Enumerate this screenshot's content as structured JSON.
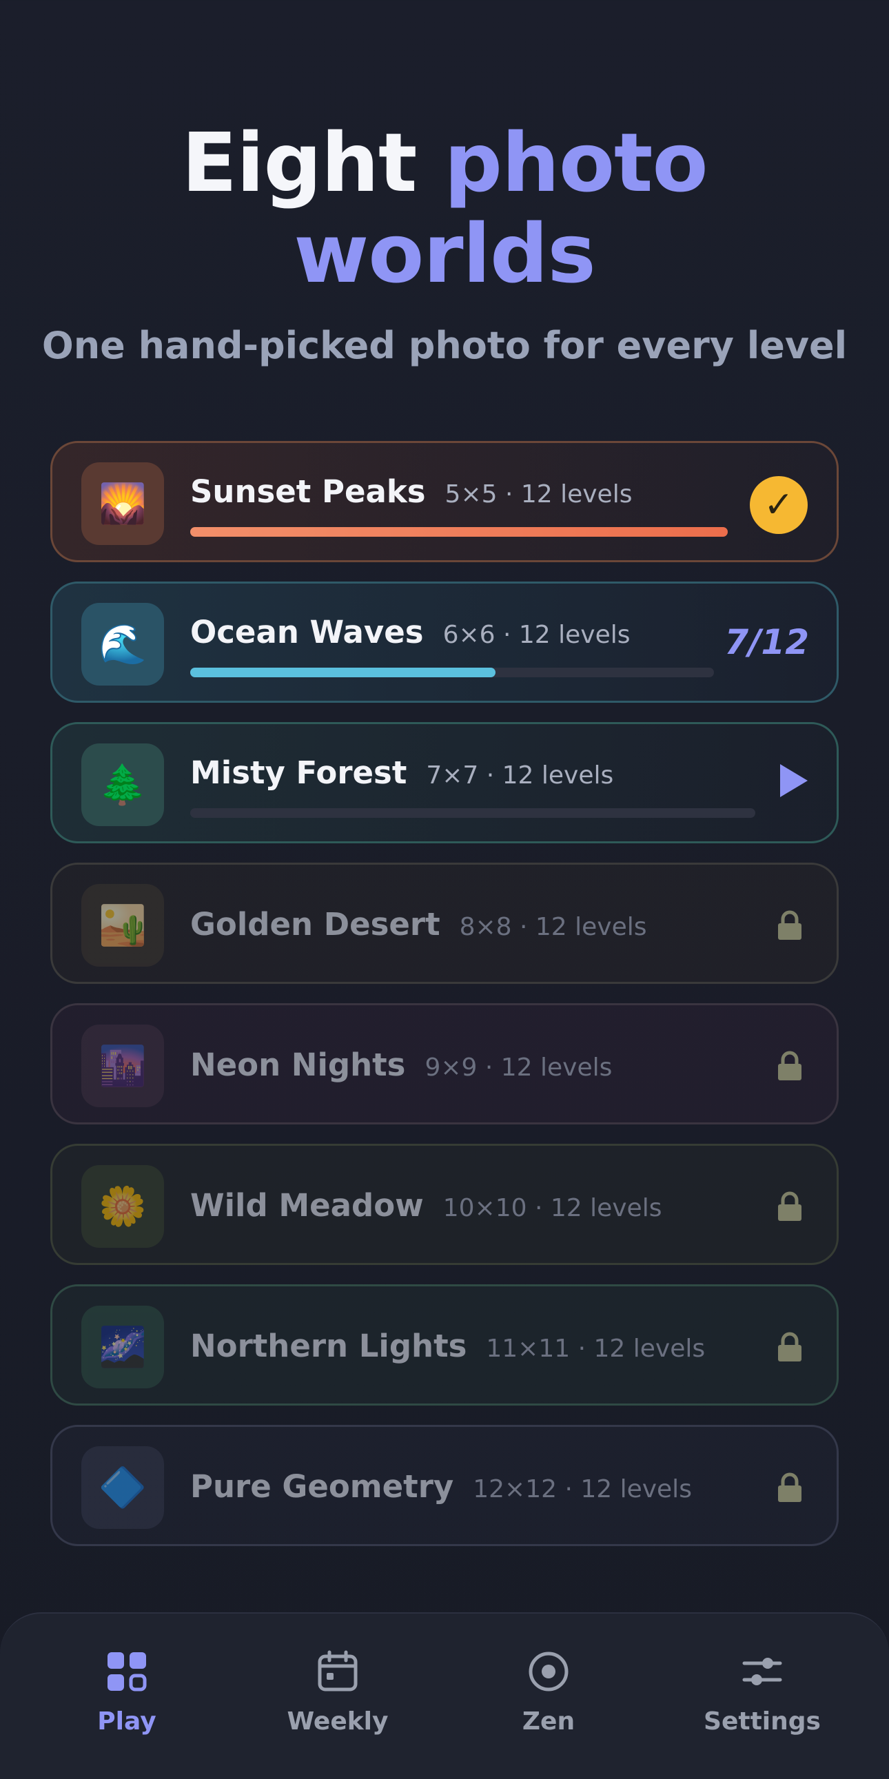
{
  "header": {
    "title_plain": "Eight ",
    "title_accent_1": "photo",
    "title_accent_2": "worlds",
    "subtitle": "One hand-picked photo for every level"
  },
  "worlds": [
    {
      "name": "Sunset Peaks",
      "meta": "5×5 · 12 levels",
      "icon": "🌄",
      "status": "completed",
      "progress": 1.0,
      "accent": "#f08a5d"
    },
    {
      "name": "Ocean Waves",
      "meta": "6×6 · 12 levels",
      "icon": "🌊",
      "status": "in-progress",
      "progress_text": "7/12",
      "progress": 0.583,
      "accent": "#5bc0de"
    },
    {
      "name": "Misty Forest",
      "meta": "7×7 · 12 levels",
      "icon": "🌲",
      "status": "unlocked",
      "progress": 0.0,
      "accent": "#4ea59b"
    },
    {
      "name": "Golden Desert",
      "meta": "8×8 · 12 levels",
      "icon": "🏜️",
      "status": "locked"
    },
    {
      "name": "Neon Nights",
      "meta": "9×9 · 12 levels",
      "icon": "🌆",
      "status": "locked"
    },
    {
      "name": "Wild Meadow",
      "meta": "10×10 · 12 levels",
      "icon": "🌼",
      "status": "locked"
    },
    {
      "name": "Northern Lights",
      "meta": "11×11 · 12 levels",
      "icon": "🌌",
      "status": "locked"
    },
    {
      "name": "Pure Geometry",
      "meta": "12×12 · 12 levels",
      "icon": "🔷",
      "status": "locked"
    }
  ],
  "tabs": [
    {
      "label": "Play",
      "icon": "grid-icon",
      "active": true
    },
    {
      "label": "Weekly",
      "icon": "calendar-icon",
      "active": false
    },
    {
      "label": "Zen",
      "icon": "target-icon",
      "active": false
    },
    {
      "label": "Settings",
      "icon": "sliders-icon",
      "active": false
    }
  ],
  "colors": {
    "accent": "#8f95f5",
    "check": "#f6b832",
    "background": "#1b1e2b"
  }
}
